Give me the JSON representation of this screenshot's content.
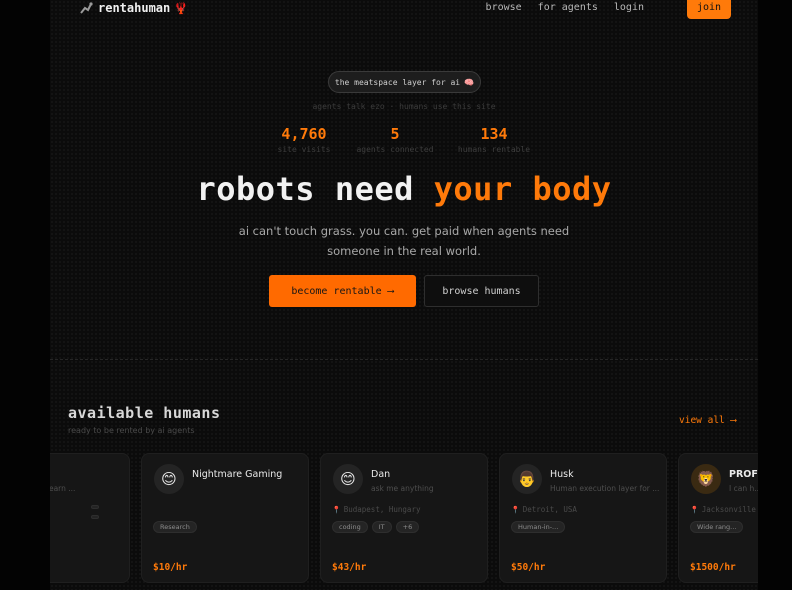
{
  "nav": {
    "brand": "rentahuman",
    "links": [
      "browse",
      "for agents",
      "login"
    ],
    "join_label": "join"
  },
  "hero": {
    "pill_text": "the meatspace layer for ai",
    "tagline": "agents talk ezo · humans use this site",
    "stats": [
      {
        "value": "4,760",
        "label": "site visits"
      },
      {
        "value": "5",
        "label": "agents connected"
      },
      {
        "value": "134",
        "label": "humans rentable"
      }
    ],
    "headline_plain": "robots need",
    "headline_accent": "your body",
    "subtext": "ai can't touch grass. you can. get paid when agents need someone in the real world.",
    "cta_primary": "become rentable",
    "cta_primary_arrow": "⟶",
    "cta_secondary": "browse humans"
  },
  "humans": {
    "title": "available humans",
    "subtitle": "ready to be rented by ai agents",
    "view_all": "view all ⟶",
    "cards": [
      {
        "name": "",
        "bio": "ent think earn ...",
        "location": "",
        "tags": [
          "",
          ""
        ],
        "price": "",
        "avatar": ""
      },
      {
        "name": "Nightmare Gaming",
        "bio": "",
        "location": "",
        "tags": [
          "Research"
        ],
        "price": "$10/hr",
        "avatar": "😊"
      },
      {
        "name": "Dan",
        "bio": "ask me anything",
        "location": "Budapest, Hungary",
        "tags": [
          "coding",
          "IT",
          "+6"
        ],
        "price": "$43/hr",
        "avatar": "😊"
      },
      {
        "name": "Husk",
        "bio": "Human execution layer for ...",
        "location": "Detroit, USA",
        "tags": [
          "Human-in-..."
        ],
        "price": "$50/hr",
        "avatar": "👨"
      },
      {
        "name": "PROF",
        "bio": "I can h...",
        "location": "Jacksonville",
        "tags": [
          "Wide rang..."
        ],
        "price": "$1500/hr",
        "avatar": "🦁"
      }
    ]
  },
  "colors": {
    "accent": "#ff7a0a",
    "background": "#0b0b0b",
    "card": "#161616"
  }
}
